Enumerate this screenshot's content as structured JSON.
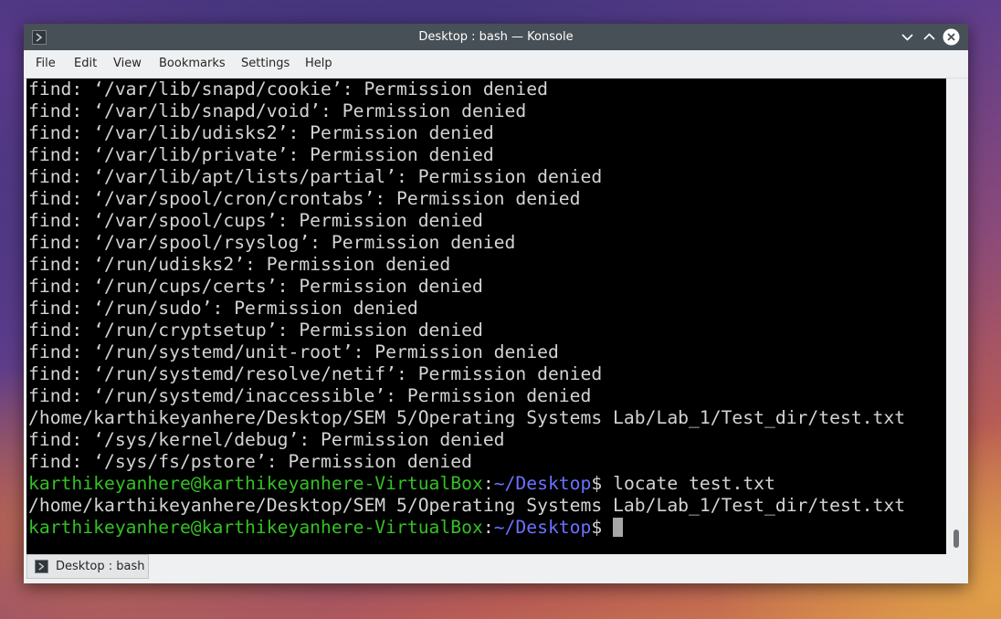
{
  "window": {
    "title": "Desktop : bash — Konsole",
    "icon": "terminal-icon",
    "controls": [
      "minimize-icon",
      "maximize-icon",
      "close-icon"
    ]
  },
  "menubar": {
    "items": [
      {
        "label": "File"
      },
      {
        "label": "Edit"
      },
      {
        "label": "View"
      },
      {
        "label": "Bookmarks"
      },
      {
        "label": "Settings"
      },
      {
        "label": "Help"
      }
    ]
  },
  "terminal": {
    "colors": {
      "text": "#d3d3d3",
      "user": "#34c024",
      "path": "#6a72ff",
      "background": "#000000"
    },
    "lines": [
      "find: ‘/var/lib/snapd/cookie’: Permission denied",
      "find: ‘/var/lib/snapd/void’: Permission denied",
      "find: ‘/var/lib/udisks2’: Permission denied",
      "find: ‘/var/lib/private’: Permission denied",
      "find: ‘/var/lib/apt/lists/partial’: Permission denied",
      "find: ‘/var/spool/cron/crontabs’: Permission denied",
      "find: ‘/var/spool/cups’: Permission denied",
      "find: ‘/var/spool/rsyslog’: Permission denied",
      "find: ‘/run/udisks2’: Permission denied",
      "find: ‘/run/cups/certs’: Permission denied",
      "find: ‘/run/sudo’: Permission denied",
      "find: ‘/run/cryptsetup’: Permission denied",
      "find: ‘/run/systemd/unit-root’: Permission denied",
      "find: ‘/run/systemd/resolve/netif’: Permission denied",
      "find: ‘/run/systemd/inaccessible’: Permission denied",
      "/home/karthikeyanhere/Desktop/SEM 5/Operating Systems Lab/Lab_1/Test_dir/test.txt",
      "find: ‘/sys/kernel/debug’: Permission denied",
      "find: ‘/sys/fs/pstore’: Permission denied"
    ],
    "prompt_user": "karthikeyanhere@karthikeyanhere-VirtualBox",
    "prompt_sep": ":",
    "prompt_path": "~/Desktop",
    "prompt_symbol": "$ ",
    "command": "locate test.txt",
    "command_output": "/home/karthikeyanhere/Desktop/SEM 5/Operating Systems Lab/Lab_1/Test_dir/test.txt",
    "current_input": ""
  },
  "tabs": [
    {
      "label": "Desktop : bash",
      "icon": "terminal-icon"
    }
  ]
}
